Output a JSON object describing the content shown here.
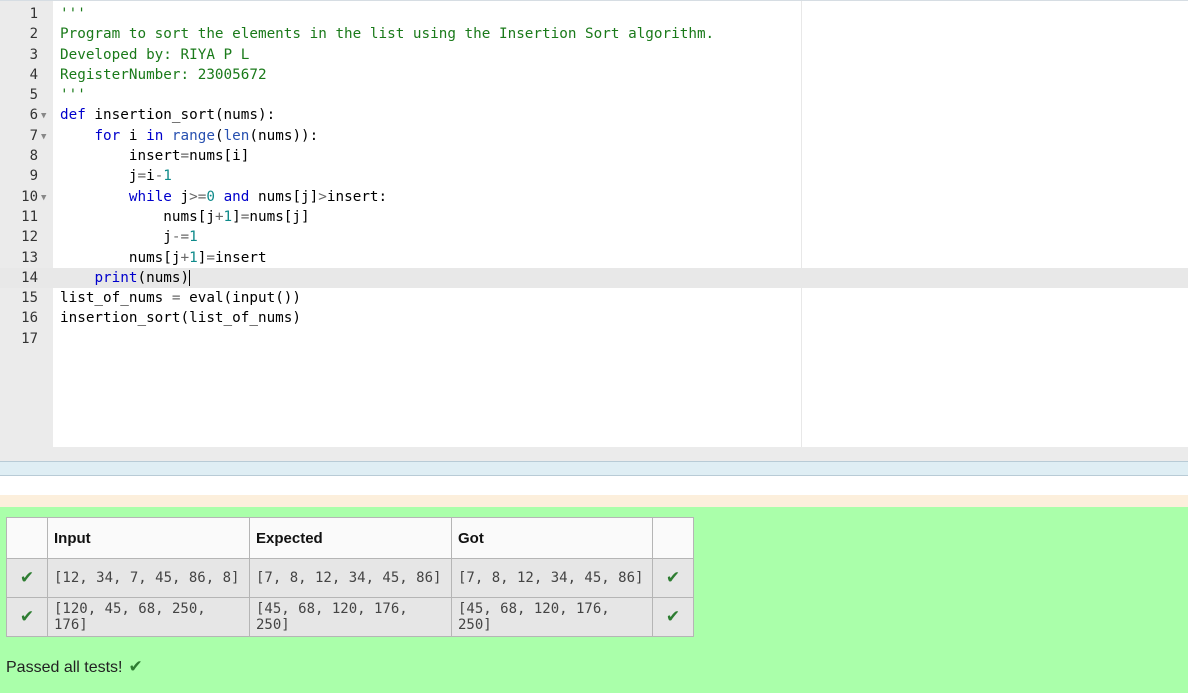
{
  "editor": {
    "lines": [
      {
        "n": "1",
        "fold": "",
        "segs": [
          {
            "t": "'''",
            "c": "c-str"
          }
        ]
      },
      {
        "n": "2",
        "fold": "",
        "segs": [
          {
            "t": "Program to sort the elements in the list using the Insertion Sort algorithm.",
            "c": "c-str"
          }
        ]
      },
      {
        "n": "3",
        "fold": "",
        "segs": [
          {
            "t": "Developed by: RIYA P L",
            "c": "c-str"
          }
        ]
      },
      {
        "n": "4",
        "fold": "",
        "segs": [
          {
            "t": "RegisterNumber: 23005672",
            "c": "c-str"
          }
        ]
      },
      {
        "n": "5",
        "fold": "",
        "segs": [
          {
            "t": "'''",
            "c": "c-str"
          }
        ]
      },
      {
        "n": "6",
        "fold": "▼",
        "segs": [
          {
            "t": "def",
            "c": "c-kw"
          },
          {
            "t": " insertion_sort(nums):",
            "c": ""
          }
        ]
      },
      {
        "n": "7",
        "fold": "▼",
        "segs": [
          {
            "t": "    ",
            "c": ""
          },
          {
            "t": "for",
            "c": "c-kw"
          },
          {
            "t": " i ",
            "c": ""
          },
          {
            "t": "in",
            "c": "c-kw"
          },
          {
            "t": " ",
            "c": ""
          },
          {
            "t": "range",
            "c": "c-bi"
          },
          {
            "t": "(",
            "c": ""
          },
          {
            "t": "len",
            "c": "c-bi"
          },
          {
            "t": "(nums)):",
            "c": ""
          }
        ]
      },
      {
        "n": "8",
        "fold": "",
        "segs": [
          {
            "t": "        insert",
            "c": ""
          },
          {
            "t": "=",
            "c": "c-op"
          },
          {
            "t": "nums[i]",
            "c": ""
          }
        ]
      },
      {
        "n": "9",
        "fold": "",
        "segs": [
          {
            "t": "        j",
            "c": ""
          },
          {
            "t": "=",
            "c": "c-op"
          },
          {
            "t": "i",
            "c": ""
          },
          {
            "t": "-",
            "c": "c-op"
          },
          {
            "t": "1",
            "c": "c-num"
          }
        ]
      },
      {
        "n": "10",
        "fold": "▼",
        "segs": [
          {
            "t": "        ",
            "c": ""
          },
          {
            "t": "while",
            "c": "c-kw"
          },
          {
            "t": " j",
            "c": ""
          },
          {
            "t": ">=",
            "c": "c-op"
          },
          {
            "t": "0",
            "c": "c-num"
          },
          {
            "t": " ",
            "c": ""
          },
          {
            "t": "and",
            "c": "c-kw"
          },
          {
            "t": " nums[j]",
            "c": ""
          },
          {
            "t": ">",
            "c": "c-op"
          },
          {
            "t": "insert:",
            "c": ""
          }
        ]
      },
      {
        "n": "11",
        "fold": "",
        "segs": [
          {
            "t": "            nums[j",
            "c": ""
          },
          {
            "t": "+",
            "c": "c-op"
          },
          {
            "t": "1",
            "c": "c-num"
          },
          {
            "t": "]",
            "c": ""
          },
          {
            "t": "=",
            "c": "c-op"
          },
          {
            "t": "nums[j]",
            "c": ""
          }
        ]
      },
      {
        "n": "12",
        "fold": "",
        "segs": [
          {
            "t": "            j",
            "c": ""
          },
          {
            "t": "-=",
            "c": "c-op"
          },
          {
            "t": "1",
            "c": "c-num"
          }
        ]
      },
      {
        "n": "13",
        "fold": "",
        "segs": [
          {
            "t": "        nums[j",
            "c": ""
          },
          {
            "t": "+",
            "c": "c-op"
          },
          {
            "t": "1",
            "c": "c-num"
          },
          {
            "t": "]",
            "c": ""
          },
          {
            "t": "=",
            "c": "c-op"
          },
          {
            "t": "insert",
            "c": ""
          }
        ]
      },
      {
        "n": "14",
        "fold": "",
        "active": true,
        "segs": [
          {
            "t": "    ",
            "c": ""
          },
          {
            "t": "print",
            "c": "c-kw"
          },
          {
            "t": "(nums)",
            "c": ""
          }
        ]
      },
      {
        "n": "15",
        "fold": "",
        "segs": [
          {
            "t": "list_of_nums ",
            "c": ""
          },
          {
            "t": "=",
            "c": "c-op"
          },
          {
            "t": " eval(input())",
            "c": ""
          }
        ]
      },
      {
        "n": "16",
        "fold": "",
        "segs": [
          {
            "t": "insertion_sort(list_of_nums)",
            "c": ""
          }
        ]
      },
      {
        "n": "17",
        "fold": "",
        "segs": []
      }
    ]
  },
  "results": {
    "headers": {
      "input": "Input",
      "expected": "Expected",
      "got": "Got"
    },
    "rows": [
      {
        "input": "[12, 34, 7, 45, 86, 8]",
        "expected": "[7, 8, 12, 34, 45, 86]",
        "got": "[7, 8, 12, 34, 45, 86]"
      },
      {
        "input": "[120, 45, 68, 250, 176]",
        "expected": "[45, 68, 120, 176, 250]",
        "got": "[45, 68, 120, 176, 250]"
      }
    ],
    "tick": "✔",
    "passed_label": "Passed all tests!"
  },
  "colors": {
    "results_bg": "#aaffaa",
    "string": "#1a7a1a",
    "keyword": "#0000cc",
    "tick": "#2e7d32"
  }
}
